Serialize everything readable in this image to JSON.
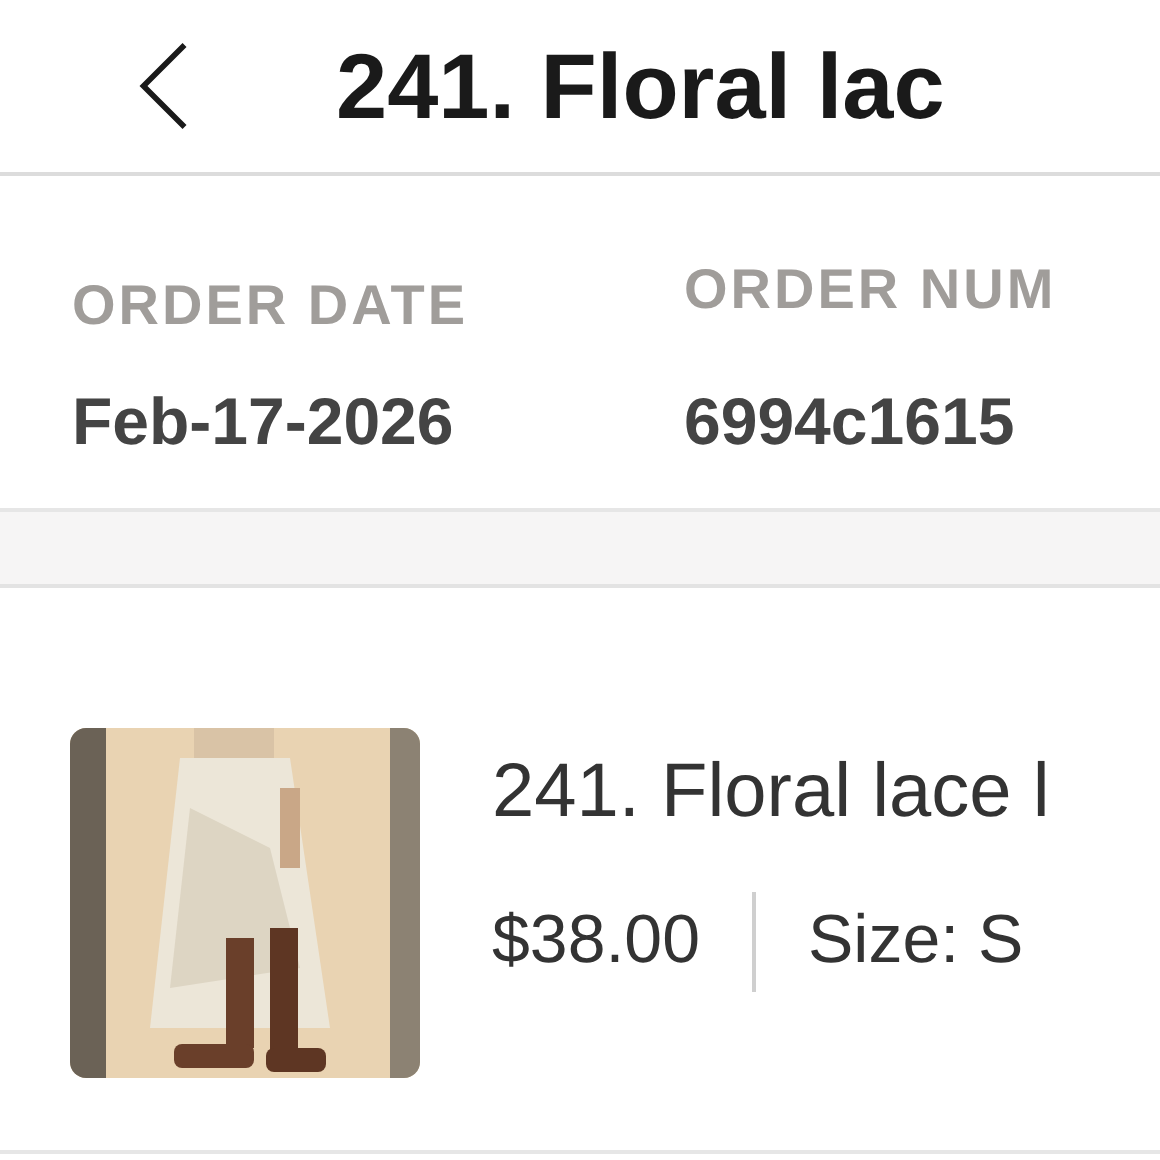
{
  "header": {
    "title": "241. Floral lac"
  },
  "order_info": [
    {
      "label": "ORDER DATE",
      "value": "Feb-17-2026"
    },
    {
      "label": "ORDER NUM",
      "value": "6994c1615"
    }
  ],
  "item": {
    "title": "241. Floral lace l",
    "price": "$38.00",
    "size": "Size: S"
  }
}
